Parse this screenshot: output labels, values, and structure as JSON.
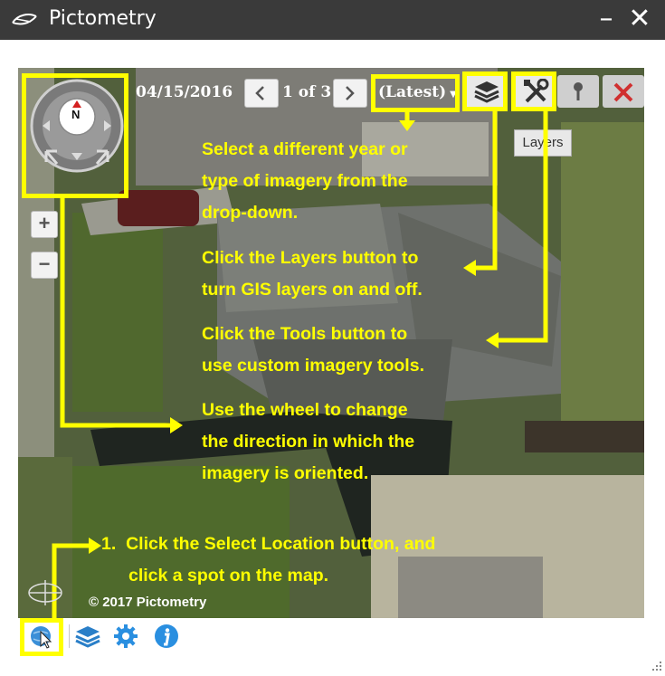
{
  "window": {
    "title": "Pictometry",
    "minimize_label": "–",
    "close_label": "✕",
    "icon": "pictometry-logo-icon"
  },
  "toolbar": {
    "date": "04/15/2016",
    "page": "1 of 3",
    "year_select": "(Latest)",
    "prev_icon": "chevron-left-icon",
    "next_icon": "chevron-right-icon",
    "layers_icon": "layers-icon",
    "tools_icon": "tools-icon",
    "pin_icon": "pin-icon",
    "delete_icon": "delete-icon",
    "tooltip": "Layers"
  },
  "map": {
    "compass_label": "N",
    "zoom_in_label": "+",
    "zoom_out_label": "−",
    "copyright": "© 2017 Pictometry"
  },
  "instructions": {
    "year_line1": "Select a different year or",
    "year_line2": "type of imagery from the",
    "year_line3": "drop-down.",
    "layers_line1": "Click the Layers button to",
    "layers_line2": "turn GIS layers on and off.",
    "tools_line1": "Click the Tools button to",
    "tools_line2": "use custom imagery tools.",
    "wheel_line1": "Use the wheel to change",
    "wheel_line2": "the direction in which the",
    "wheel_line3": "imagery is oriented.",
    "select_line1": "1.  Click the Select Location button, and",
    "select_line2": "click a spot on the map."
  },
  "bottom_toolbar": {
    "select_location_icon": "select-location-icon",
    "layers_icon": "layers-icon",
    "settings_icon": "gear-icon",
    "info_icon": "info-icon"
  },
  "colors": {
    "highlight": "#ffff00",
    "titlebar": "#3a3a3a",
    "accent_blue": "#1e90e0"
  }
}
